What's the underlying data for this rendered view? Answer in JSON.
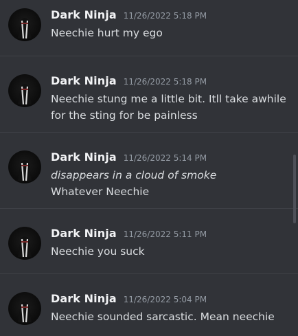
{
  "messages": [
    {
      "author": "Dark Ninja",
      "timestamp": "11/26/2022 5:18 PM",
      "lines": [
        "Neechie hurt my ego"
      ]
    },
    {
      "author": "Dark Ninja",
      "timestamp": "11/26/2022 5:18 PM",
      "lines": [
        "Neechie stung me a little bit. Itll take awhile",
        "for the sting for be painless"
      ]
    },
    {
      "author": "Dark Ninja",
      "timestamp": "11/26/2022 5:14 PM",
      "lines": [
        "disappears in a cloud of smoke",
        "Whatever Neechie"
      ]
    },
    {
      "author": "Dark Ninja",
      "timestamp": "11/26/2022 5:11 PM",
      "lines": [
        "Neechie you suck"
      ]
    },
    {
      "author": "Dark Ninja",
      "timestamp": "11/26/2022 5:04 PM",
      "lines": [
        "Neechie sounded sarcastic. Mean neechie"
      ]
    }
  ],
  "colors": {
    "background": "#313338",
    "author": "#f2f3f5",
    "timestamp": "#949ba4",
    "text": "#dbdee1",
    "divider": "#3f4147"
  },
  "icons": {
    "avatar": "ninja-avatar-icon"
  }
}
